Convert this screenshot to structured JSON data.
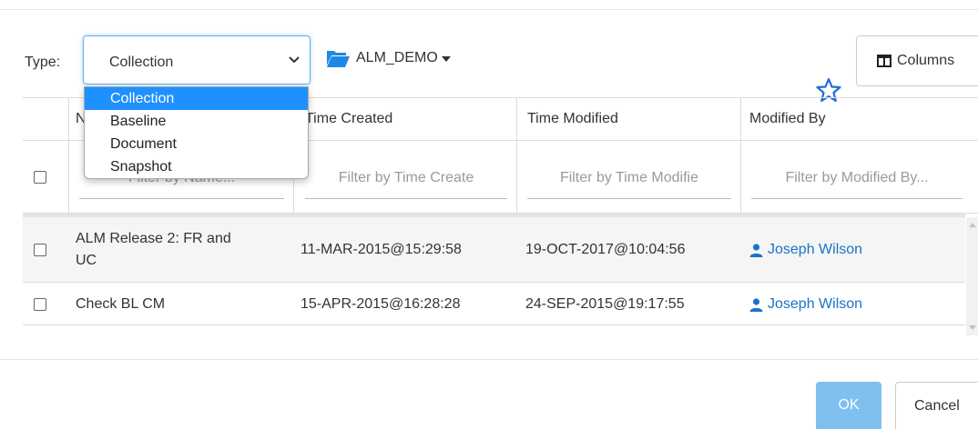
{
  "toolbar": {
    "type_label": "Type:",
    "type_value": "Collection",
    "repository": "ALM_DEMO",
    "columns_label": "Columns"
  },
  "type_options": [
    "Collection",
    "Baseline",
    "Document",
    "Snapshot"
  ],
  "table": {
    "headers": [
      "N",
      "Time Created",
      "Time Modified",
      "Modified By"
    ],
    "filter_placeholders": [
      "Filter by Name...",
      "Filter by Time Create",
      "Filter by Time Modifie",
      "Filter by Modified By..."
    ],
    "rows": [
      {
        "name_line1": "ALM Release 2: FR and",
        "name_line2": "UC",
        "created": "11-MAR-2015@15:29:58",
        "modified": "19-OCT-2017@10:04:56",
        "modified_by": "Joseph Wilson"
      },
      {
        "name_line1": "Check BL CM",
        "name_line2": "",
        "created": "15-APR-2015@16:28:28",
        "modified": "24-SEP-2015@19:17:55",
        "modified_by": "Joseph Wilson"
      }
    ]
  },
  "footer": {
    "ok_label": "OK",
    "cancel_label": "Cancel"
  },
  "colors": {
    "accent": "#1e90ff",
    "link": "#1a73c8",
    "folder": "#1e88e5",
    "ok_disabled": "#7fc0f1"
  },
  "icons": {
    "folder": "folder-open-icon",
    "star": "star-outline-icon",
    "columns": "columns-icon",
    "user": "user-icon",
    "chevron": "chevron-down-icon"
  }
}
